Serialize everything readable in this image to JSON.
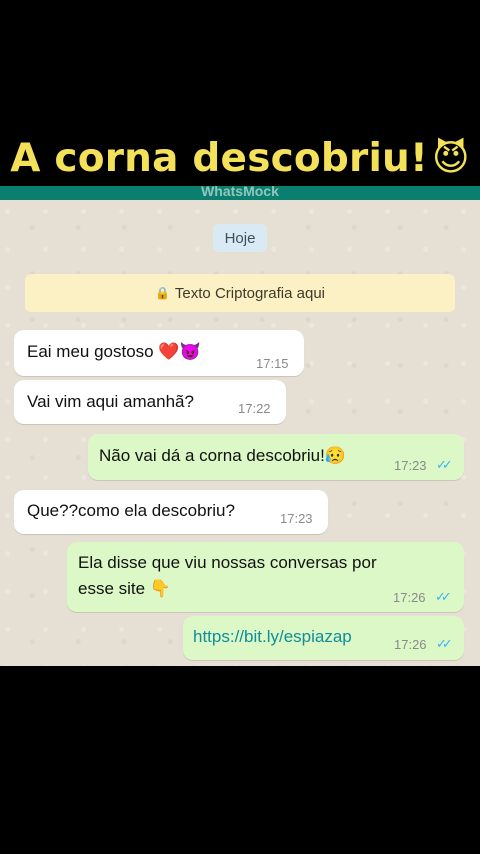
{
  "title": {
    "text": "A corna descobriu!",
    "emoji": "😈"
  },
  "header": {
    "app_name": "WhatsMock"
  },
  "chat": {
    "date_chip": "Hoje",
    "crypto_banner": "Texto Criptografia aqui",
    "messages": [
      {
        "direction": "in",
        "text": "Eai meu gostoso ❤️😈",
        "time": "17:15"
      },
      {
        "direction": "in",
        "text": "Vai vim aqui amanhã?",
        "time": "17:22"
      },
      {
        "direction": "out",
        "text": "Não vai dá a corna descobriu!😥",
        "time": "17:23",
        "read": true
      },
      {
        "direction": "in",
        "text": "Que??como ela descobriu?",
        "time": "17:23"
      },
      {
        "direction": "out",
        "text_line1": "Ela disse que viu nossas conversas por",
        "text_line2": "esse site 👇",
        "time": "17:26",
        "read": true
      },
      {
        "direction": "out",
        "text": "https://bit.ly/espiazap",
        "time": "17:26",
        "read": true
      }
    ]
  },
  "colors": {
    "title": "#f4e15a",
    "header": "#0a7f6f",
    "outgoing_bubble": "#dcf8c6",
    "incoming_bubble": "#ffffff",
    "read_ticks": "#34b7f1"
  }
}
